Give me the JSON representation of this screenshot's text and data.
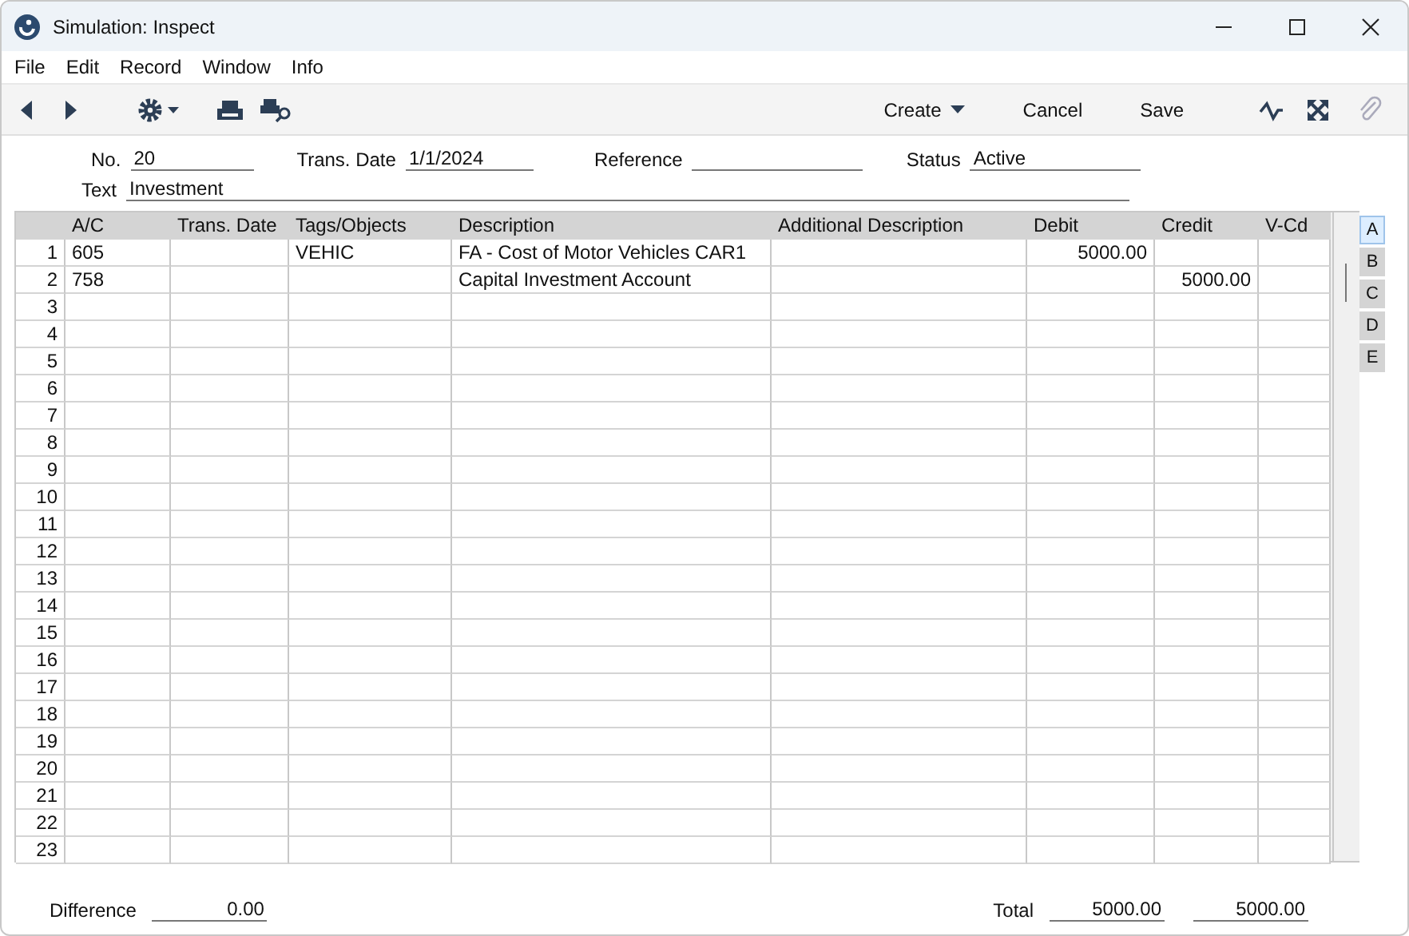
{
  "window": {
    "title": "Simulation: Inspect"
  },
  "menu": [
    "File",
    "Edit",
    "Record",
    "Window",
    "Info"
  ],
  "toolbar": {
    "create": "Create",
    "cancel": "Cancel",
    "save": "Save"
  },
  "header": {
    "no_label": "No.",
    "no": "20",
    "date_label": "Trans. Date",
    "date": "1/1/2024",
    "reference_label": "Reference",
    "status_label": "Status",
    "status": "Active",
    "text_label": "Text",
    "text": "Investment"
  },
  "table": {
    "columns": [
      "A/C",
      "Trans. Date",
      "Tags/Objects",
      "Description",
      "Additional Description",
      "Debit",
      "Credit",
      "V-Cd"
    ],
    "rows": [
      {
        "number": "1",
        "ac": "605",
        "tags": "VEHIC",
        "description": "FA - Cost of Motor Vehicles CAR1",
        "debit": "5000.00"
      },
      {
        "number": "2",
        "ac": "758",
        "description": "Capital Investment Account",
        "credit": "5000.00"
      },
      {
        "number": "3"
      },
      {
        "number": "4"
      },
      {
        "number": "5"
      },
      {
        "number": "6"
      },
      {
        "number": "7"
      },
      {
        "number": "8"
      },
      {
        "number": "9"
      },
      {
        "number": "10"
      },
      {
        "number": "11"
      },
      {
        "number": "12"
      },
      {
        "number": "13"
      },
      {
        "number": "14"
      },
      {
        "number": "15"
      },
      {
        "number": "16"
      },
      {
        "number": "17"
      },
      {
        "number": "18"
      },
      {
        "number": "19"
      },
      {
        "number": "20"
      },
      {
        "number": "21"
      },
      {
        "number": "22"
      },
      {
        "number": "23"
      }
    ]
  },
  "side_tabs": [
    {
      "label": "A",
      "selected": true
    },
    {
      "label": "B",
      "selected": false
    },
    {
      "label": "C",
      "selected": false
    },
    {
      "label": "D",
      "selected": false
    },
    {
      "label": "E",
      "selected": false
    }
  ],
  "footer": {
    "difference_label": "Difference",
    "difference": "0.00",
    "total_label": "Total",
    "total_debit": "5000.00",
    "total_credit": "5000.00"
  }
}
